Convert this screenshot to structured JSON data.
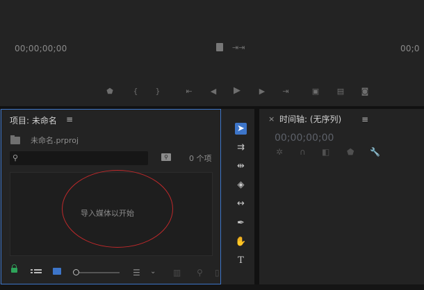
{
  "monitor": {
    "timecode_left": "00;00;00;00",
    "timecode_right": "00;0",
    "controls": [
      "marker-icon",
      "in-point-icon",
      "out-point-icon",
      "go-to-in-icon",
      "step-back-icon",
      "play-icon",
      "step-forward-icon",
      "go-to-out-icon",
      "insert-icon",
      "overwrite-icon",
      "camera-icon"
    ]
  },
  "project": {
    "title": "项目: 未命名",
    "menu": "≡",
    "file": "未命名.prproj",
    "search_placeholder": "",
    "item_count": "0 个项",
    "drop_hint": "导入媒体以开始"
  },
  "tools": [
    "selection-tool",
    "track-select-tool",
    "ripple-edit-tool",
    "razor-tool",
    "slip-tool",
    "pen-tool",
    "hand-tool",
    "type-tool"
  ],
  "timeline": {
    "close": "×",
    "title": "时间轴: (无序列)",
    "menu": "≡",
    "timecode": "00;00;00;00"
  },
  "colors": {
    "accent": "#3d75c9",
    "annotation": "#c0292b",
    "lock": "#2ea35a"
  }
}
